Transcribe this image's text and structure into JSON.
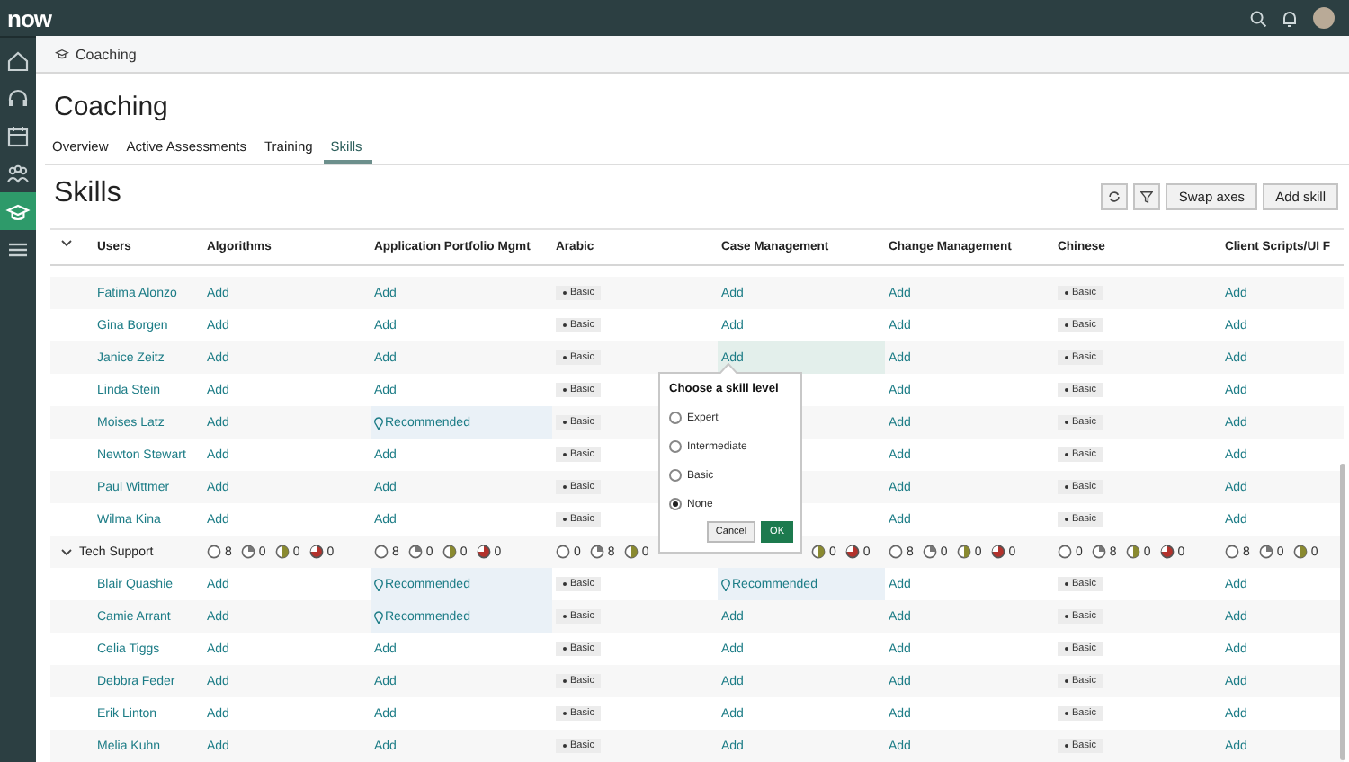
{
  "top_bar": {
    "logo": "now"
  },
  "sidebar": {
    "items": [
      {
        "kind": "home",
        "selected": false
      },
      {
        "kind": "headset",
        "selected": false
      },
      {
        "kind": "calendar",
        "selected": false
      },
      {
        "kind": "people",
        "selected": false
      },
      {
        "kind": "cap",
        "selected": true
      },
      {
        "kind": "list",
        "selected": false
      }
    ]
  },
  "breadcrumb": {
    "label": "Coaching"
  },
  "page_title": "Coaching",
  "tabs": [
    {
      "label": "Overview",
      "selected": false
    },
    {
      "label": "Active Assessments",
      "selected": false
    },
    {
      "label": "Training",
      "selected": false
    },
    {
      "label": "Skills",
      "selected": true
    }
  ],
  "section_title": "Skills",
  "toolbar": {
    "buttons": [
      {
        "kind": "refresh"
      },
      {
        "kind": "filter"
      },
      {
        "kind": "text",
        "label": "Swap axes"
      },
      {
        "kind": "text",
        "label": "Add skill"
      }
    ]
  },
  "table": {
    "columns": [
      "Users",
      "Algorithms",
      "Application Portfolio Mgmt",
      "Arabic",
      "Case Management",
      "Change Management",
      "Chinese",
      "Client Scripts/UI F"
    ],
    "rows": [
      {
        "kind": "user",
        "name": "Fatima Alonzo",
        "cells": [
          {
            "kind": "add",
            "text": "Add"
          },
          {
            "kind": "add",
            "text": "Add"
          },
          {
            "kind": "level",
            "text": "Basic"
          },
          {
            "kind": "add",
            "text": "Add"
          },
          {
            "kind": "add",
            "text": "Add"
          },
          {
            "kind": "level",
            "text": "Basic"
          },
          {
            "kind": "add",
            "text": "Add"
          }
        ]
      },
      {
        "kind": "user",
        "name": "Gina Borgen",
        "cells": [
          {
            "kind": "add",
            "text": "Add"
          },
          {
            "kind": "add",
            "text": "Add"
          },
          {
            "kind": "level",
            "text": "Basic"
          },
          {
            "kind": "add",
            "text": "Add"
          },
          {
            "kind": "add",
            "text": "Add"
          },
          {
            "kind": "level",
            "text": "Basic"
          },
          {
            "kind": "add",
            "text": "Add"
          }
        ]
      },
      {
        "kind": "user",
        "name": "Janice Zeitz",
        "cells": [
          {
            "kind": "add",
            "text": "Add"
          },
          {
            "kind": "add",
            "text": "Add"
          },
          {
            "kind": "level",
            "text": "Basic"
          },
          {
            "kind": "add",
            "text": "Add",
            "selected": true
          },
          {
            "kind": "add",
            "text": "Add"
          },
          {
            "kind": "level",
            "text": "Basic"
          },
          {
            "kind": "add",
            "text": "Add"
          }
        ]
      },
      {
        "kind": "user",
        "name": "Linda Stein",
        "cells": [
          {
            "kind": "add",
            "text": "Add"
          },
          {
            "kind": "add",
            "text": "Add"
          },
          {
            "kind": "level",
            "text": "Basic"
          },
          null,
          {
            "kind": "add",
            "text": "Add"
          },
          {
            "kind": "level",
            "text": "Basic"
          },
          {
            "kind": "add",
            "text": "Add"
          }
        ]
      },
      {
        "kind": "user",
        "name": "Moises Latz",
        "cells": [
          {
            "kind": "add",
            "text": "Add"
          },
          {
            "kind": "recommended",
            "text": "Recommended"
          },
          {
            "kind": "level",
            "text": "Basic"
          },
          null,
          {
            "kind": "add",
            "text": "Add"
          },
          {
            "kind": "level",
            "text": "Basic"
          },
          {
            "kind": "add",
            "text": "Add"
          }
        ]
      },
      {
        "kind": "user",
        "name": "Newton Stewart",
        "cells": [
          {
            "kind": "add",
            "text": "Add"
          },
          {
            "kind": "add",
            "text": "Add"
          },
          {
            "kind": "level",
            "text": "Basic"
          },
          null,
          {
            "kind": "add",
            "text": "Add"
          },
          {
            "kind": "level",
            "text": "Basic"
          },
          {
            "kind": "add",
            "text": "Add"
          }
        ]
      },
      {
        "kind": "user",
        "name": "Paul Wittmer",
        "cells": [
          {
            "kind": "add",
            "text": "Add"
          },
          {
            "kind": "add",
            "text": "Add"
          },
          {
            "kind": "level",
            "text": "Basic"
          },
          null,
          {
            "kind": "add",
            "text": "Add"
          },
          {
            "kind": "level",
            "text": "Basic"
          },
          {
            "kind": "add",
            "text": "Add"
          }
        ]
      },
      {
        "kind": "user",
        "name": "Wilma Kina",
        "cells": [
          {
            "kind": "add",
            "text": "Add"
          },
          {
            "kind": "add",
            "text": "Add"
          },
          {
            "kind": "level",
            "text": "Basic"
          },
          null,
          {
            "kind": "add",
            "text": "Add"
          },
          {
            "kind": "level",
            "text": "Basic"
          },
          {
            "kind": "add",
            "text": "Add"
          }
        ]
      },
      {
        "kind": "group",
        "name": "Tech Support",
        "expanded": true,
        "summaries": [
          [
            {
              "kind": "empty",
              "count": "8"
            },
            {
              "kind": "quarter",
              "count": "0"
            },
            {
              "kind": "half",
              "count": "0"
            },
            {
              "kind": "full",
              "count": "0"
            }
          ],
          [
            {
              "kind": "empty",
              "count": "8"
            },
            {
              "kind": "quarter",
              "count": "0"
            },
            {
              "kind": "half",
              "count": "0"
            },
            {
              "kind": "full",
              "count": "0"
            }
          ],
          [
            {
              "kind": "empty",
              "count": "0"
            },
            {
              "kind": "quarter",
              "count": "8"
            },
            {
              "kind": "half",
              "count": "0"
            }
          ],
          [
            {
              "kind": "half",
              "count": "0"
            },
            {
              "kind": "full",
              "count": "0"
            }
          ],
          [
            {
              "kind": "empty",
              "count": "8"
            },
            {
              "kind": "quarter",
              "count": "0"
            },
            {
              "kind": "half",
              "count": "0"
            },
            {
              "kind": "full",
              "count": "0"
            }
          ],
          [
            {
              "kind": "empty",
              "count": "0"
            },
            {
              "kind": "quarter",
              "count": "8"
            },
            {
              "kind": "half",
              "count": "0"
            },
            {
              "kind": "full",
              "count": "0"
            }
          ],
          [
            {
              "kind": "empty",
              "count": "8"
            },
            {
              "kind": "quarter",
              "count": "0"
            },
            {
              "kind": "half",
              "count": "0"
            }
          ]
        ]
      },
      {
        "kind": "user",
        "name": "Blair Quashie",
        "cells": [
          {
            "kind": "add",
            "text": "Add"
          },
          {
            "kind": "recommended",
            "text": "Recommended"
          },
          {
            "kind": "level",
            "text": "Basic"
          },
          {
            "kind": "recommended",
            "text": "Recommended"
          },
          {
            "kind": "add",
            "text": "Add"
          },
          {
            "kind": "level",
            "text": "Basic"
          },
          {
            "kind": "add",
            "text": "Add"
          }
        ]
      },
      {
        "kind": "user",
        "name": "Camie Arrant",
        "cells": [
          {
            "kind": "add",
            "text": "Add"
          },
          {
            "kind": "recommended",
            "text": "Recommended"
          },
          {
            "kind": "level",
            "text": "Basic"
          },
          {
            "kind": "add",
            "text": "Add"
          },
          {
            "kind": "add",
            "text": "Add"
          },
          {
            "kind": "level",
            "text": "Basic"
          },
          {
            "kind": "add",
            "text": "Add"
          }
        ]
      },
      {
        "kind": "user",
        "name": "Celia Tiggs",
        "cells": [
          {
            "kind": "add",
            "text": "Add"
          },
          {
            "kind": "add",
            "text": "Add"
          },
          {
            "kind": "level",
            "text": "Basic"
          },
          {
            "kind": "add",
            "text": "Add"
          },
          {
            "kind": "add",
            "text": "Add"
          },
          {
            "kind": "level",
            "text": "Basic"
          },
          {
            "kind": "add",
            "text": "Add"
          }
        ]
      },
      {
        "kind": "user",
        "name": "Debbra Feder",
        "cells": [
          {
            "kind": "add",
            "text": "Add"
          },
          {
            "kind": "add",
            "text": "Add"
          },
          {
            "kind": "level",
            "text": "Basic"
          },
          {
            "kind": "add",
            "text": "Add"
          },
          {
            "kind": "add",
            "text": "Add"
          },
          {
            "kind": "level",
            "text": "Basic"
          },
          {
            "kind": "add",
            "text": "Add"
          }
        ]
      },
      {
        "kind": "user",
        "name": "Erik Linton",
        "cells": [
          {
            "kind": "add",
            "text": "Add"
          },
          {
            "kind": "add",
            "text": "Add"
          },
          {
            "kind": "level",
            "text": "Basic"
          },
          {
            "kind": "add",
            "text": "Add"
          },
          {
            "kind": "add",
            "text": "Add"
          },
          {
            "kind": "level",
            "text": "Basic"
          },
          {
            "kind": "add",
            "text": "Add"
          }
        ]
      },
      {
        "kind": "user",
        "name": "Melia Kuhn",
        "cells": [
          {
            "kind": "add",
            "text": "Add"
          },
          {
            "kind": "add",
            "text": "Add"
          },
          {
            "kind": "level",
            "text": "Basic"
          },
          {
            "kind": "add",
            "text": "Add"
          },
          {
            "kind": "add",
            "text": "Add"
          },
          {
            "kind": "level",
            "text": "Basic"
          },
          {
            "kind": "add",
            "text": "Add"
          }
        ]
      }
    ]
  },
  "popover": {
    "title": "Choose a skill level",
    "options": [
      {
        "label": "Expert",
        "selected": false
      },
      {
        "label": "Intermediate",
        "selected": false
      },
      {
        "label": "Basic",
        "selected": false
      },
      {
        "label": "None",
        "selected": true
      }
    ],
    "buttons": [
      {
        "kind": "secondary",
        "label": "Cancel"
      },
      {
        "kind": "primary",
        "label": "OK"
      }
    ]
  }
}
